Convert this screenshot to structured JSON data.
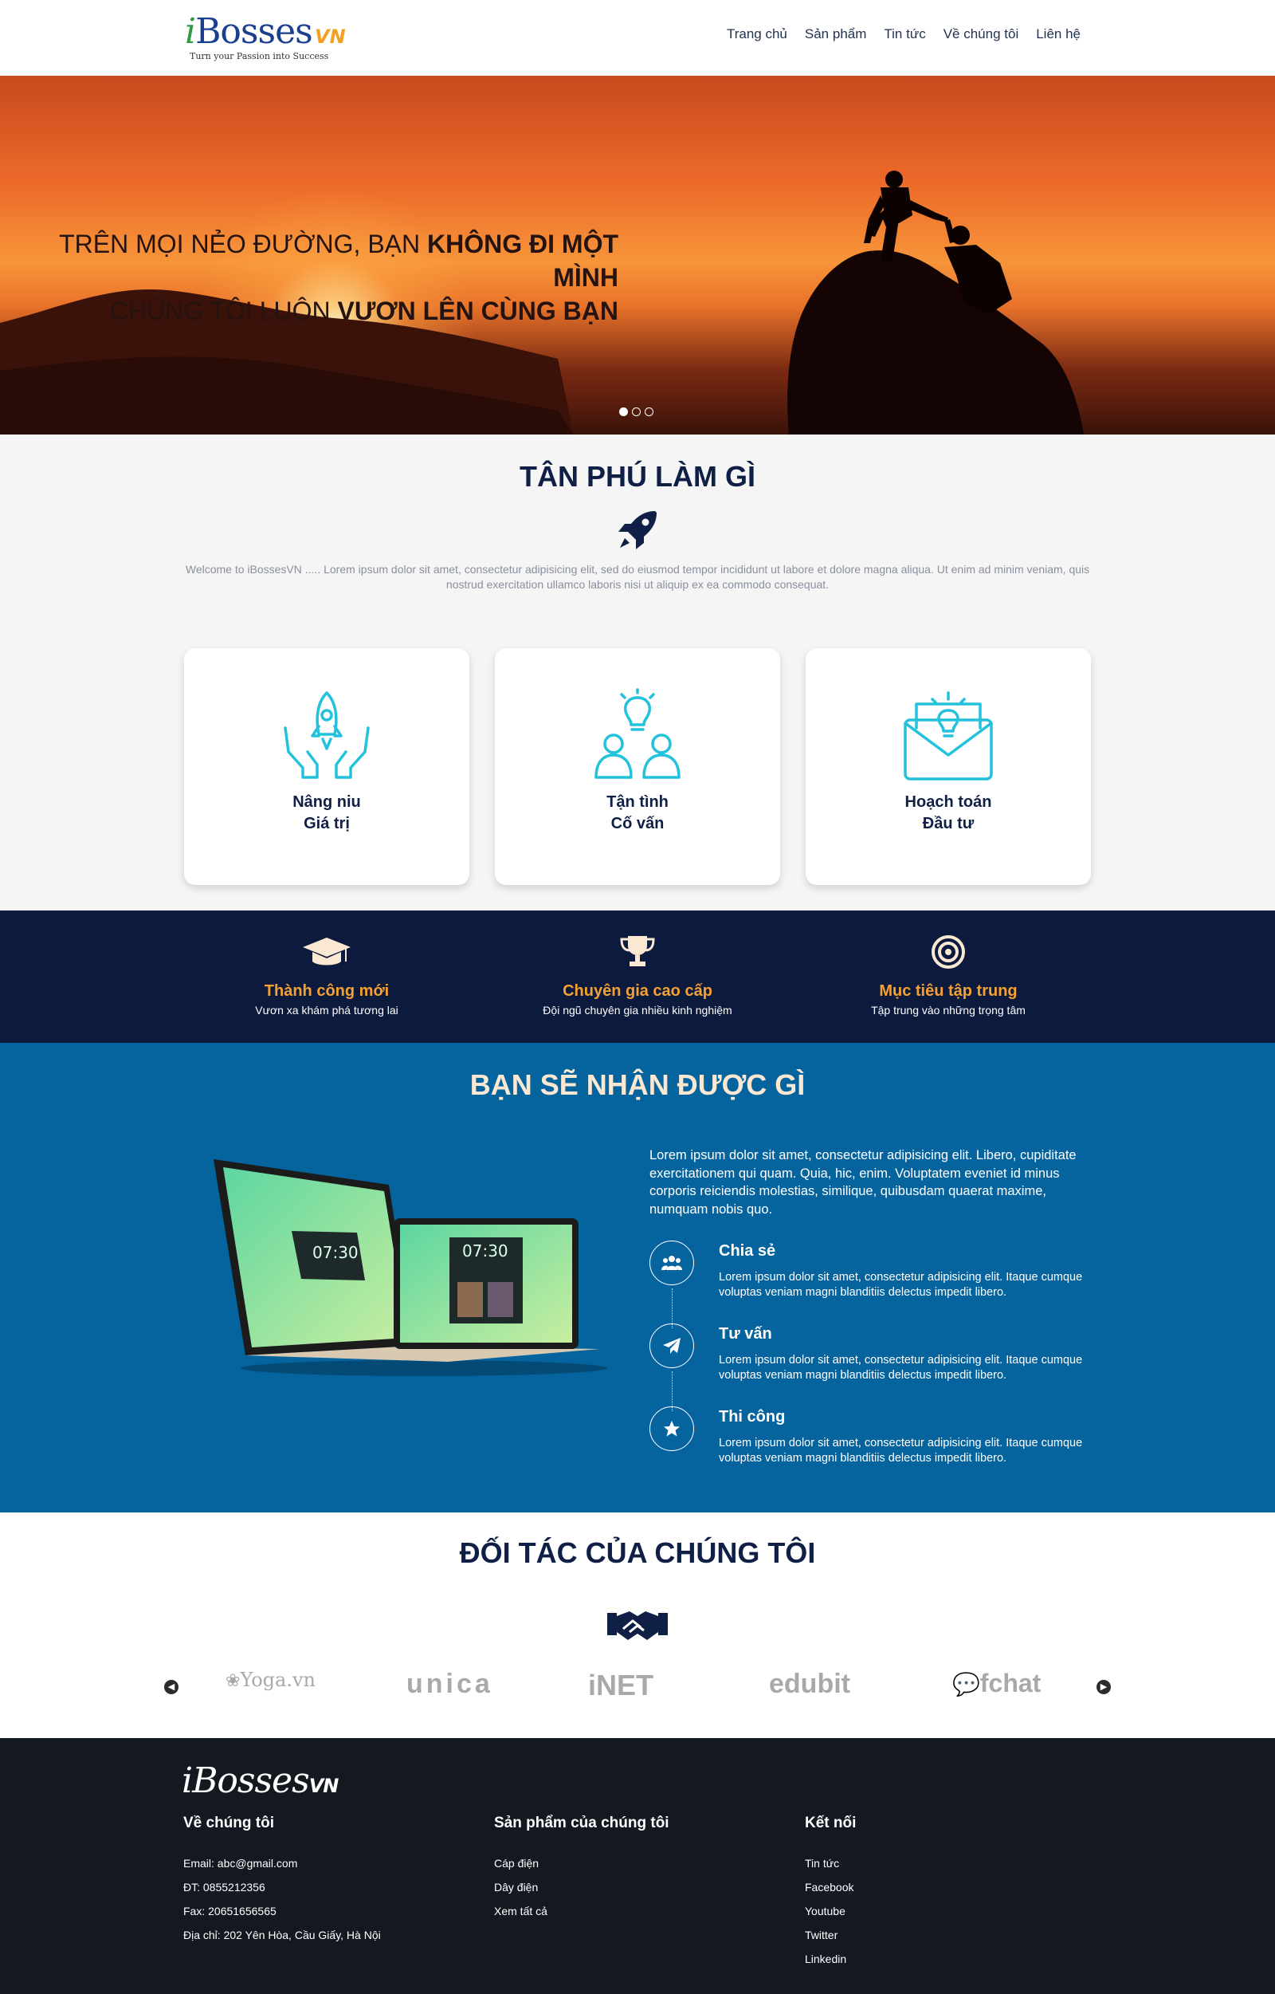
{
  "header": {
    "logo_main": "Bosses",
    "logo_i": "i",
    "logo_vn": "VN",
    "logo_tagline": "Turn your Passion into Success",
    "nav": [
      "Trang chủ",
      "Sản phẩm",
      "Tin tức",
      "Về chúng tôi",
      "Liên hệ"
    ]
  },
  "hero": {
    "line1_normal": "TRÊN MỌI NẺO ĐƯỜNG, BẠN ",
    "line1_bold": "KHÔNG ĐI MỘT MÌNH",
    "line2_normal": "CHÚNG TÔI LUÔN ",
    "line2_bold": "VƯƠN LÊN CÙNG BẠN",
    "slide_count": 3,
    "active_slide": 1
  },
  "what": {
    "title": "TÂN PHÚ LÀM GÌ",
    "intro": "Welcome to iBossesVN ..... Lorem ipsum dolor sit amet, consectetur adipisicing elit, sed do eiusmod tempor incididunt ut labore et dolore magna aliqua. Ut enim ad minim veniam, quis nostrud exercitation ullamco laboris nisi ut aliquip ex ea commodo consequat.",
    "cards": [
      {
        "line1": "Nâng niu",
        "line2": "Giá trị",
        "icon": "rocket-hands-icon"
      },
      {
        "line1": "Tận tình",
        "line2": "Cố vấn",
        "icon": "team-idea-icon"
      },
      {
        "line1": "Hoạch toán",
        "line2": "Đầu tư",
        "icon": "envelope-idea-icon"
      }
    ]
  },
  "band": {
    "items": [
      {
        "title": "Thành công mới",
        "sub": "Vươn xa khám phá tương lai",
        "icon": "graduation-cap-icon"
      },
      {
        "title": "Chuyên gia cao cấp",
        "sub": "Đội ngũ chuyên gia nhiều kinh nghiệm",
        "icon": "trophy-icon"
      },
      {
        "title": "Mục tiêu tập trung",
        "sub": "Tập trung vào những trọng tâm",
        "icon": "target-icon"
      }
    ]
  },
  "benefits": {
    "title": "BẠN SẼ NHẬN ĐƯỢC GÌ",
    "lead": "Lorem ipsum dolor sit amet, consectetur adipisicing elit. Libero, cupiditate exercitationem qui quam. Quia, hic, enim. Voluptatem eveniet id minus corporis reiciendis molestias, similique, quibusdam quaerat maxime, numquam nobis quo.",
    "screen_time": "07:30",
    "items": [
      {
        "title": "Chia sẻ",
        "text": "Lorem ipsum dolor sit amet, consectetur adipisicing elit. Itaque cumque voluptas veniam magni blanditiis delectus impedit libero.",
        "icon": "users-icon"
      },
      {
        "title": "Tư vấn",
        "text": "Lorem ipsum dolor sit amet, consectetur adipisicing elit. Itaque cumque voluptas veniam magni blanditiis delectus impedit libero.",
        "icon": "paper-plane-icon"
      },
      {
        "title": "Thi công",
        "text": "Lorem ipsum dolor sit amet, consectetur adipisicing elit. Itaque cumque voluptas veniam magni blanditiis delectus impedit libero.",
        "icon": "star-icon"
      }
    ]
  },
  "partners": {
    "title": "ĐỐI TÁC CỦA CHÚNG TÔI",
    "logos": [
      "Yoga.vn",
      "unica",
      "iNET",
      "edubit",
      "fchat"
    ]
  },
  "footer": {
    "logo_main": "iBosses",
    "logo_vn": "VN",
    "col1": {
      "head": "Về chúng tôi",
      "rows": [
        "Email: abc@gmail.com",
        "ĐT: 0855212356",
        "Fax: 20651656565",
        "Địa chỉ: 202 Yên Hòa, Cầu Giấy, Hà Nội"
      ]
    },
    "col2": {
      "head": "Sản phẩm của chúng tôi",
      "rows": [
        "Cáp điện",
        "Dây điện",
        "Xem tất cả"
      ]
    },
    "col3": {
      "head": "Kết nối",
      "rows": [
        "Tin tức",
        "Facebook",
        "Youtube",
        "Twitter",
        "Linkedin"
      ]
    }
  }
}
